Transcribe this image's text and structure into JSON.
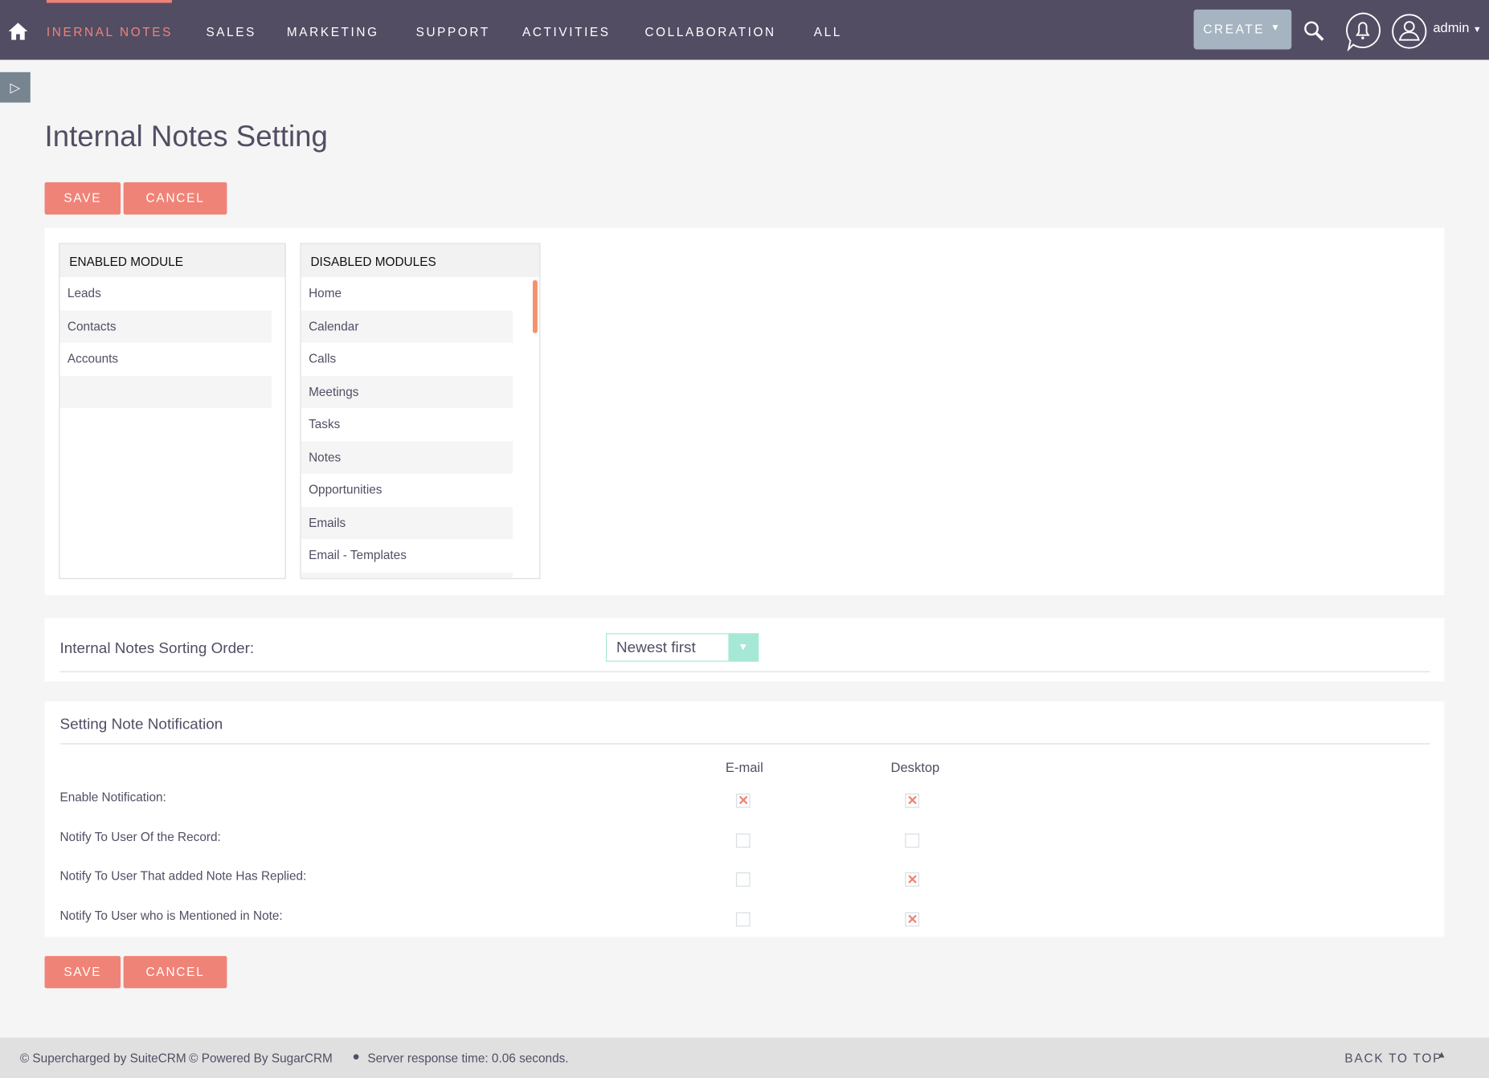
{
  "nav": {
    "items": [
      "INERNAL NOTES",
      "SALES",
      "MARKETING",
      "SUPPORT",
      "ACTIVITIES",
      "COLLABORATION",
      "ALL"
    ],
    "create": "CREATE",
    "user": "admin",
    "accent": "#f08377",
    "bar": "#534d64"
  },
  "page": {
    "title": "Internal Notes Setting",
    "save": "SAVE",
    "cancel": "CANCEL"
  },
  "enabled": {
    "header": "ENABLED MODULE",
    "items": [
      "Leads",
      "Contacts",
      "Accounts",
      ""
    ]
  },
  "disabled": {
    "header": "DISABLED MODULES",
    "items": [
      "Home",
      "Calendar",
      "Calls",
      "Meetings",
      "Tasks",
      "Notes",
      "Opportunities",
      "Emails",
      "Email - Templates"
    ]
  },
  "sorting": {
    "label": "Internal Notes Sorting Order:",
    "value": "Newest first"
  },
  "notification": {
    "title": "Setting Note Notification",
    "col_email": "E-mail",
    "col_desktop": "Desktop",
    "rows": [
      {
        "label": "Enable Notification:",
        "email": true,
        "desktop": true
      },
      {
        "label": "Notify To User Of the Record:",
        "email": false,
        "desktop": false
      },
      {
        "label": "Notify To User That added Note Has Replied:",
        "email": false,
        "desktop": true
      },
      {
        "label": "Notify To User who is Mentioned in Note:",
        "email": false,
        "desktop": true
      }
    ]
  },
  "footer": {
    "suite": "© Supercharged by SuiteCRM",
    "sugar": "© Powered By SugarCRM",
    "response": "Server response time: 0.06 seconds.",
    "back": "BACK TO TOP"
  }
}
